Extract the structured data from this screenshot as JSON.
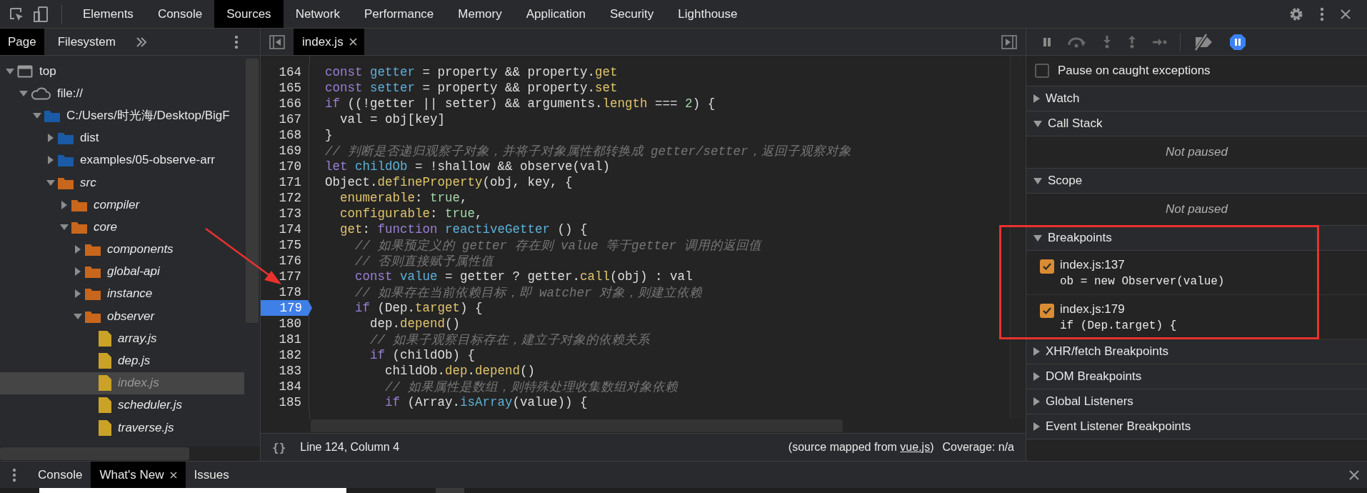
{
  "main_tabs": [
    {
      "label": "Elements",
      "selected": false
    },
    {
      "label": "Console",
      "selected": false
    },
    {
      "label": "Sources",
      "selected": true
    },
    {
      "label": "Network",
      "selected": false
    },
    {
      "label": "Performance",
      "selected": false
    },
    {
      "label": "Memory",
      "selected": false
    },
    {
      "label": "Application",
      "selected": false
    },
    {
      "label": "Security",
      "selected": false
    },
    {
      "label": "Lighthouse",
      "selected": false
    }
  ],
  "navigator": {
    "tabs": [
      {
        "label": "Page",
        "selected": true
      },
      {
        "label": "Filesystem",
        "selected": false
      }
    ],
    "tree": [
      {
        "label": "top",
        "kind": "frame",
        "expanded": true,
        "selected": false,
        "mapped": false,
        "children": [
          {
            "label": "file://",
            "kind": "domain",
            "expanded": true,
            "selected": false,
            "mapped": false,
            "children": [
              {
                "label": "C:/Users/时光海/Desktop/BigF",
                "kind": "folder",
                "color": "#1a5aa6",
                "expanded": true,
                "selected": false,
                "mapped": false,
                "children": [
                  {
                    "label": "dist",
                    "kind": "folder",
                    "color": "#1a5aa6",
                    "expanded": false,
                    "selected": false,
                    "mapped": false
                  },
                  {
                    "label": "examples/05-observe-arr",
                    "kind": "folder",
                    "color": "#1a5aa6",
                    "expanded": false,
                    "selected": false,
                    "mapped": false
                  },
                  {
                    "label": "src",
                    "kind": "folder",
                    "color": "#c8661c",
                    "expanded": true,
                    "selected": false,
                    "mapped": true,
                    "children": [
                      {
                        "label": "compiler",
                        "kind": "folder",
                        "color": "#c8661c",
                        "expanded": false,
                        "selected": false,
                        "mapped": true
                      },
                      {
                        "label": "core",
                        "kind": "folder",
                        "color": "#c8661c",
                        "expanded": true,
                        "selected": false,
                        "mapped": true,
                        "children": [
                          {
                            "label": "components",
                            "kind": "folder",
                            "color": "#c8661c",
                            "expanded": false,
                            "selected": false,
                            "mapped": true
                          },
                          {
                            "label": "global-api",
                            "kind": "folder",
                            "color": "#c8661c",
                            "expanded": false,
                            "selected": false,
                            "mapped": true
                          },
                          {
                            "label": "instance",
                            "kind": "folder",
                            "color": "#c8661c",
                            "expanded": false,
                            "selected": false,
                            "mapped": true
                          },
                          {
                            "label": "observer",
                            "kind": "folder",
                            "color": "#c8661c",
                            "expanded": true,
                            "selected": false,
                            "mapped": true,
                            "children": [
                              {
                                "label": "array.js",
                                "kind": "file",
                                "color": "#c9a227",
                                "selected": false,
                                "mapped": true
                              },
                              {
                                "label": "dep.js",
                                "kind": "file",
                                "color": "#c9a227",
                                "selected": false,
                                "mapped": true
                              },
                              {
                                "label": "index.js",
                                "kind": "file",
                                "color": "#c9a227",
                                "selected": true,
                                "mapped": true
                              },
                              {
                                "label": "scheduler.js",
                                "kind": "file",
                                "color": "#c9a227",
                                "selected": false,
                                "mapped": true
                              },
                              {
                                "label": "traverse.js",
                                "kind": "file",
                                "color": "#c9a227",
                                "selected": false,
                                "mapped": true
                              }
                            ]
                          }
                        ]
                      }
                    ]
                  }
                ]
              }
            ]
          }
        ]
      }
    ]
  },
  "editor": {
    "tabs": [
      {
        "label": "index.js",
        "selected": true
      }
    ],
    "lines": [
      {
        "num": "164",
        "breakpoint": false,
        "tokens": [
          {
            "kind": "keyword",
            "text": "const "
          },
          {
            "kind": "variable",
            "text": "getter"
          },
          {
            "kind": "plain",
            "text": " = property && property."
          },
          {
            "kind": "property",
            "text": "get"
          }
        ]
      },
      {
        "num": "165",
        "breakpoint": false,
        "tokens": [
          {
            "kind": "keyword",
            "text": "const "
          },
          {
            "kind": "variable",
            "text": "setter"
          },
          {
            "kind": "plain",
            "text": " = property && property."
          },
          {
            "kind": "property",
            "text": "set"
          }
        ]
      },
      {
        "num": "166",
        "breakpoint": false,
        "tokens": [
          {
            "kind": "keyword",
            "text": "if"
          },
          {
            "kind": "plain",
            "text": " ((!getter || setter) && arguments."
          },
          {
            "kind": "property",
            "text": "length"
          },
          {
            "kind": "plain",
            "text": " === "
          },
          {
            "kind": "literal",
            "text": "2"
          },
          {
            "kind": "plain",
            "text": ") {"
          }
        ]
      },
      {
        "num": "167",
        "breakpoint": false,
        "tokens": [
          {
            "kind": "plain",
            "text": "  val = obj[key]"
          }
        ]
      },
      {
        "num": "168",
        "breakpoint": false,
        "tokens": [
          {
            "kind": "plain",
            "text": "}"
          }
        ]
      },
      {
        "num": "169",
        "breakpoint": false,
        "tokens": [
          {
            "kind": "comment",
            "text": "// 判断是否递归观察子对象，并将子对象属性都转换成 getter/setter，返回子观察对象"
          }
        ]
      },
      {
        "num": "170",
        "breakpoint": false,
        "tokens": [
          {
            "kind": "keyword",
            "text": "let "
          },
          {
            "kind": "variable",
            "text": "childOb"
          },
          {
            "kind": "plain",
            "text": " = !shallow && observe(val)"
          }
        ]
      },
      {
        "num": "171",
        "breakpoint": false,
        "tokens": [
          {
            "kind": "plain",
            "text": "Object."
          },
          {
            "kind": "property",
            "text": "defineProperty"
          },
          {
            "kind": "plain",
            "text": "(obj, key, {"
          }
        ]
      },
      {
        "num": "172",
        "breakpoint": false,
        "tokens": [
          {
            "kind": "property",
            "text": "  enumerable"
          },
          {
            "kind": "plain",
            "text": ": "
          },
          {
            "kind": "literal",
            "text": "true"
          },
          {
            "kind": "plain",
            "text": ","
          }
        ]
      },
      {
        "num": "173",
        "breakpoint": false,
        "tokens": [
          {
            "kind": "property",
            "text": "  configurable"
          },
          {
            "kind": "plain",
            "text": ": "
          },
          {
            "kind": "literal",
            "text": "true"
          },
          {
            "kind": "plain",
            "text": ","
          }
        ]
      },
      {
        "num": "174",
        "breakpoint": false,
        "tokens": [
          {
            "kind": "property",
            "text": "  get"
          },
          {
            "kind": "plain",
            "text": ": "
          },
          {
            "kind": "keyword",
            "text": "function "
          },
          {
            "kind": "variable",
            "text": "reactiveGetter"
          },
          {
            "kind": "plain",
            "text": " () {"
          }
        ]
      },
      {
        "num": "175",
        "breakpoint": false,
        "tokens": [
          {
            "kind": "comment",
            "text": "    // 如果预定义的 getter 存在则 value 等于getter 调用的返回值"
          }
        ]
      },
      {
        "num": "176",
        "breakpoint": false,
        "tokens": [
          {
            "kind": "comment",
            "text": "    // 否则直接赋予属性值"
          }
        ]
      },
      {
        "num": "177",
        "breakpoint": false,
        "tokens": [
          {
            "kind": "keyword",
            "text": "    const "
          },
          {
            "kind": "variable",
            "text": "value"
          },
          {
            "kind": "plain",
            "text": " = getter ? getter."
          },
          {
            "kind": "property",
            "text": "call"
          },
          {
            "kind": "plain",
            "text": "(obj) : val"
          }
        ]
      },
      {
        "num": "178",
        "breakpoint": false,
        "tokens": [
          {
            "kind": "comment",
            "text": "    // 如果存在当前依赖目标，即 watcher 对象，则建立依赖"
          }
        ]
      },
      {
        "num": "179",
        "breakpoint": true,
        "tokens": [
          {
            "kind": "keyword",
            "text": "    if"
          },
          {
            "kind": "plain",
            "text": " (Dep."
          },
          {
            "kind": "property",
            "text": "target"
          },
          {
            "kind": "plain",
            "text": ") {"
          }
        ]
      },
      {
        "num": "180",
        "breakpoint": false,
        "tokens": [
          {
            "kind": "plain",
            "text": "      dep."
          },
          {
            "kind": "property",
            "text": "depend"
          },
          {
            "kind": "plain",
            "text": "()"
          }
        ]
      },
      {
        "num": "181",
        "breakpoint": false,
        "tokens": [
          {
            "kind": "comment",
            "text": "      // 如果子观察目标存在，建立子对象的依赖关系"
          }
        ]
      },
      {
        "num": "182",
        "breakpoint": false,
        "tokens": [
          {
            "kind": "keyword",
            "text": "      if"
          },
          {
            "kind": "plain",
            "text": " (childOb) {"
          }
        ]
      },
      {
        "num": "183",
        "breakpoint": false,
        "tokens": [
          {
            "kind": "plain",
            "text": "        childOb."
          },
          {
            "kind": "property",
            "text": "dep"
          },
          {
            "kind": "plain",
            "text": "."
          },
          {
            "kind": "property",
            "text": "depend"
          },
          {
            "kind": "plain",
            "text": "()"
          }
        ]
      },
      {
        "num": "184",
        "breakpoint": false,
        "tokens": [
          {
            "kind": "comment",
            "text": "        // 如果属性是数组，则特殊处理收集数组对象依赖"
          }
        ]
      },
      {
        "num": "185",
        "breakpoint": false,
        "tokens": [
          {
            "kind": "keyword",
            "text": "        if"
          },
          {
            "kind": "plain",
            "text": " (Array."
          },
          {
            "kind": "variable",
            "text": "isArray"
          },
          {
            "kind": "plain",
            "text": "(value)) {"
          }
        ]
      }
    ],
    "status": {
      "format": "{}",
      "position": "Line 124, Column 4",
      "source_prefix": "(source mapped from ",
      "source_link": "vue.js",
      "source_suffix": ")",
      "coverage": "Coverage: n/a"
    }
  },
  "debugger": {
    "pause_on_caught": {
      "label": "Pause on caught exceptions",
      "checked": false
    },
    "sections": [
      {
        "title": "Watch",
        "expanded": false
      },
      {
        "title": "Call Stack",
        "expanded": true,
        "empty": "Not paused"
      },
      {
        "title": "Scope",
        "expanded": true,
        "empty": "Not paused"
      },
      {
        "title": "Breakpoints",
        "expanded": true,
        "breakpoints": [
          {
            "location": "index.js:137",
            "code": "ob = new Observer(value)",
            "checked": true
          },
          {
            "location": "index.js:179",
            "code": "if (Dep.target) {",
            "checked": true
          }
        ]
      },
      {
        "title": "XHR/fetch Breakpoints",
        "expanded": false
      },
      {
        "title": "DOM Breakpoints",
        "expanded": false
      },
      {
        "title": "Global Listeners",
        "expanded": false
      },
      {
        "title": "Event Listener Breakpoints",
        "expanded": false
      }
    ]
  },
  "drawer": {
    "tabs": [
      {
        "label": "Console",
        "selected": false,
        "closable": false
      },
      {
        "label": "What's New",
        "selected": true,
        "closable": true
      },
      {
        "label": "Issues",
        "selected": false,
        "closable": false
      }
    ]
  },
  "annotations": {
    "arrow": true,
    "highlight_box": true
  }
}
